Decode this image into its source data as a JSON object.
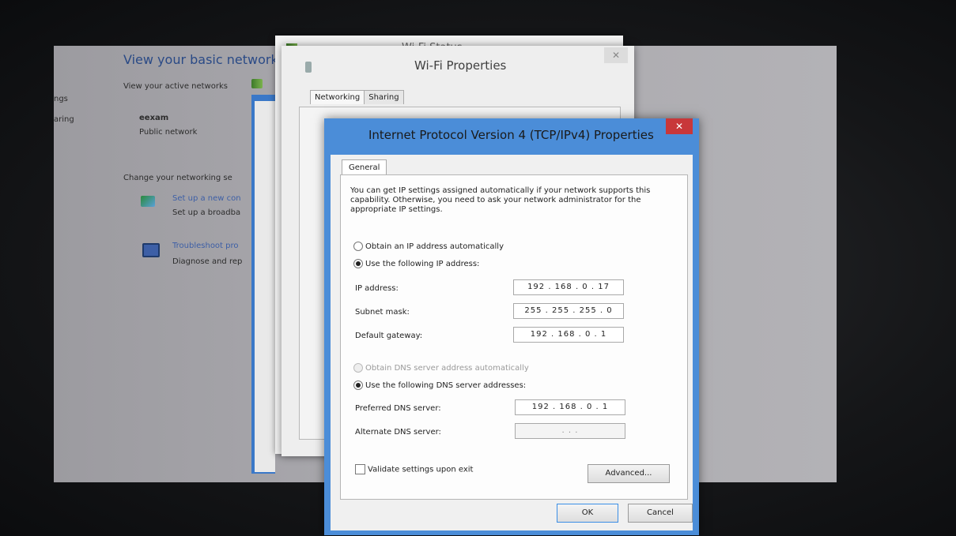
{
  "control_panel": {
    "title": "View your basic network i",
    "active_networks_label": "View your active networks",
    "sidebar_fragments": [
      "ngs",
      "aring"
    ],
    "network_name": "eexam",
    "network_type": "Public network",
    "change_settings_label": "Change your networking se",
    "setup_link": "Set up a new con",
    "setup_desc": "Set up a broadba",
    "troubleshoot_link": "Troubleshoot pro",
    "troubleshoot_desc": "Diagnose and rep"
  },
  "wifi_status": {
    "title": "Wi-Fi Status"
  },
  "wifi_properties": {
    "title": "Wi-Fi Properties",
    "tabs": [
      "Networking",
      "Sharing"
    ]
  },
  "ipv4": {
    "title": "Internet Protocol Version 4 (TCP/IPv4) Properties",
    "close_glyph": "✕",
    "tab_general": "General",
    "description": "You can get IP settings assigned automatically if your network supports this capability. Otherwise, you need to ask your network administrator for the appropriate IP settings.",
    "obtain_ip_auto": "Obtain an IP address automatically",
    "use_following_ip": "Use the following IP address:",
    "ip_address_label": "IP address:",
    "ip_address": "192 . 168 .  0  .  17",
    "subnet_mask_label": "Subnet mask:",
    "subnet_mask": "255 . 255 . 255 .  0",
    "default_gateway_label": "Default gateway:",
    "default_gateway": "192 . 168 .  0  .  1",
    "obtain_dns_auto": "Obtain DNS server address automatically",
    "use_following_dns": "Use the following DNS server addresses:",
    "preferred_dns_label": "Preferred DNS server:",
    "preferred_dns": "192 . 168 .  0  .  1",
    "alternate_dns_label": "Alternate DNS server:",
    "alternate_dns": "   .     .     .   ",
    "validate_label": "Validate settings upon exit",
    "advanced_button": "Advanced...",
    "ok_button": "OK",
    "cancel_button": "Cancel"
  },
  "colors": {
    "dialog_border": "#4b8dd8",
    "close_red": "#c8373a",
    "link_blue": "#3d5fa6"
  }
}
